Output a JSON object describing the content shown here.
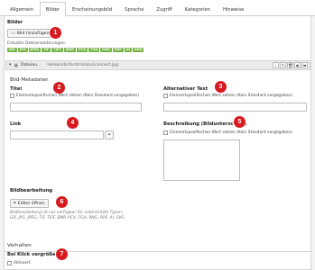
{
  "tabs": [
    {
      "label": "Allgemein",
      "active": false
    },
    {
      "label": "Bilder",
      "active": true
    },
    {
      "label": "Erscheinungsbild",
      "active": false
    },
    {
      "label": "Sprache",
      "active": false
    },
    {
      "label": "Zugriff",
      "active": false
    },
    {
      "label": "Kategorien",
      "active": false
    },
    {
      "label": "Hinweise",
      "active": false
    }
  ],
  "images": {
    "label": "Bilder",
    "add_button": "Bild hinzufügen",
    "allowed_label": "Erlaubte Dateierweiterungen:",
    "formats": [
      "GIF",
      "JPG",
      "JPEG",
      "TIF",
      "TIFF",
      "BMP",
      "PCX",
      "TGA",
      "PNG",
      "PDF",
      "AI",
      "SVG"
    ],
    "file_title": "Dateiau...",
    "file_name": "Heinersdorferstr-Vision1connect.jpg",
    "file_icons": [
      "i",
      "✎",
      "🗑",
      "◉",
      "▬"
    ]
  },
  "metadata": {
    "heading": "Bild-Metadaten",
    "title_label": "Titel",
    "alt_label": "Alternativer Text",
    "link_label": "Link",
    "description_label": "Beschreibung (Bildunterschrift)",
    "override_text": "Elementspezifischen Wert setzen (Kein Standard vorgegeben)"
  },
  "editing": {
    "label": "Bildbearbeitung",
    "editor_button": "Editor öffnen",
    "hint_line1": "Bildbearbeitung ist nur verfügbar für unterstützte Typen:",
    "hint_line2": "GIF, JPG, JPEG, TIF, TIFF, BMP, PCX, TGA, PNG, PDF, AI, SVG"
  },
  "behaviour": {
    "heading": "Verhalten",
    "enlarge_label": "Bei Klick vergrößern",
    "active_label": "Aktiviert"
  },
  "markers": [
    "1",
    "2",
    "3",
    "4",
    "5",
    "6",
    "7"
  ],
  "colors": {
    "format_badge": "#79b54a",
    "marker": "#d71920"
  }
}
